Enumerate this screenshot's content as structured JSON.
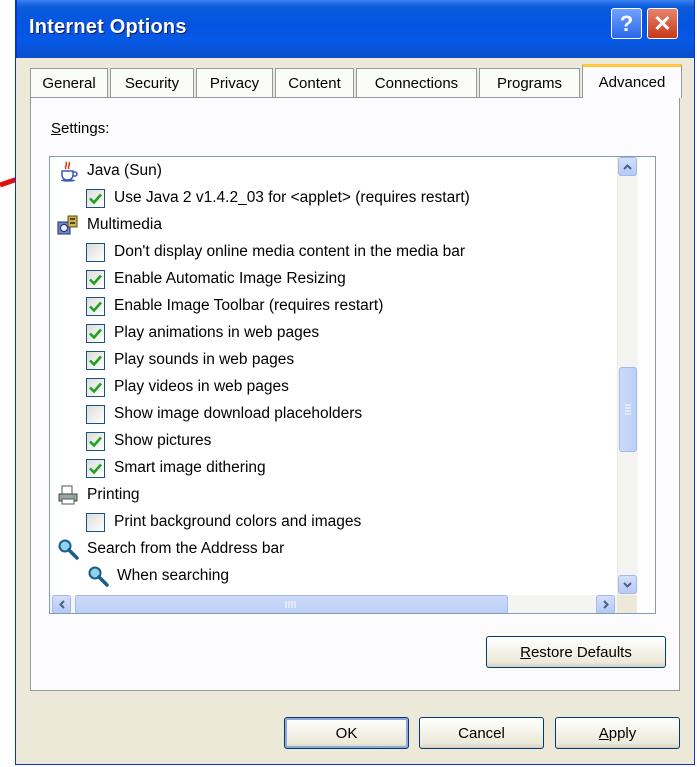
{
  "window": {
    "title": "Internet Options",
    "help_glyph": "?",
    "close_glyph": "✕"
  },
  "tabs": [
    {
      "label": "General"
    },
    {
      "label": "Security"
    },
    {
      "label": "Privacy"
    },
    {
      "label": "Content"
    },
    {
      "label": "Connections"
    },
    {
      "label": "Programs"
    },
    {
      "label": "Advanced",
      "active": true
    }
  ],
  "settings": {
    "label_underlined": "S",
    "label_rest": "ettings:",
    "items": [
      {
        "type": "category",
        "icon": "java-cup-icon",
        "label": "Java (Sun)"
      },
      {
        "type": "checkbox",
        "checked": true,
        "label": "Use Java 2 v1.4.2_03 for <applet> (requires restart)"
      },
      {
        "type": "category",
        "icon": "multimedia-icon",
        "label": "Multimedia"
      },
      {
        "type": "checkbox",
        "checked": false,
        "label": "Don't display online media content in the media bar"
      },
      {
        "type": "checkbox",
        "checked": true,
        "label": "Enable Automatic Image Resizing"
      },
      {
        "type": "checkbox",
        "checked": true,
        "label": "Enable Image Toolbar (requires restart)"
      },
      {
        "type": "checkbox",
        "checked": true,
        "label": "Play animations in web pages"
      },
      {
        "type": "checkbox",
        "checked": true,
        "label": "Play sounds in web pages"
      },
      {
        "type": "checkbox",
        "checked": true,
        "label": "Play videos in web pages"
      },
      {
        "type": "checkbox",
        "checked": false,
        "label": "Show image download placeholders"
      },
      {
        "type": "checkbox",
        "checked": true,
        "label": "Show pictures"
      },
      {
        "type": "checkbox",
        "checked": true,
        "label": "Smart image dithering"
      },
      {
        "type": "category",
        "icon": "printer-icon",
        "label": "Printing"
      },
      {
        "type": "checkbox",
        "checked": false,
        "label": "Print background colors and images"
      },
      {
        "type": "category",
        "icon": "magnifier-icon",
        "label": "Search from the Address bar"
      },
      {
        "type": "subcategory",
        "icon": "magnifier-icon",
        "label": "When searching"
      }
    ],
    "scroll_position": 0.62
  },
  "buttons": {
    "restore_defaults_underlined": "R",
    "restore_defaults_rest": "estore Defaults",
    "ok": "OK",
    "cancel": "Cancel",
    "apply_underlined": "A",
    "apply_rest": "pply"
  },
  "colors": {
    "title_bar": "#0554e2",
    "check_mark": "#21a121",
    "annotation_arrow": "#e01010"
  }
}
